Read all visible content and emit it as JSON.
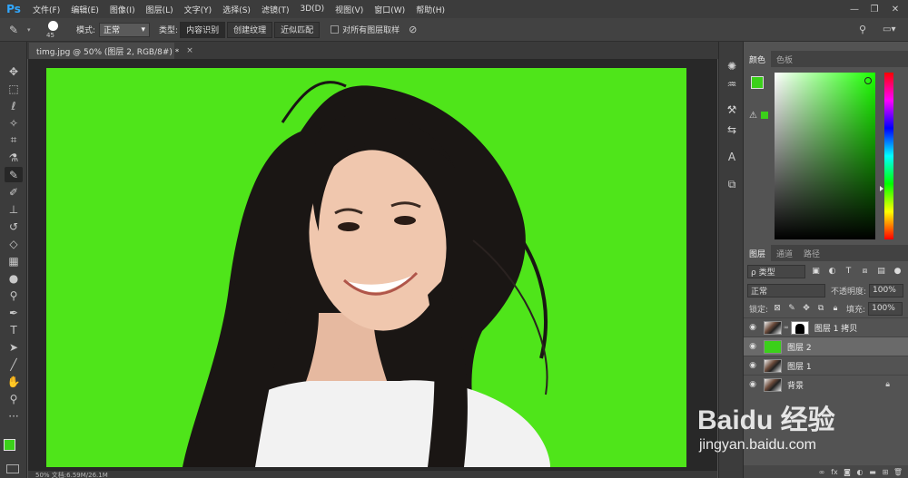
{
  "app": {
    "logo": "Ps"
  },
  "menu": [
    "文件(F)",
    "编辑(E)",
    "图像(I)",
    "图层(L)",
    "文字(Y)",
    "选择(S)",
    "滤镜(T)",
    "3D(D)",
    "视图(V)",
    "窗口(W)",
    "帮助(H)"
  ],
  "window_controls": {
    "minimize": "—",
    "restore": "❐",
    "close": "✕"
  },
  "options": {
    "brush_size": "45",
    "mode_label": "模式:",
    "mode_value": "正常",
    "type_label": "类型:",
    "type_buttons": [
      "内容识别",
      "创建纹理",
      "近似匹配"
    ],
    "sample_all_label": "对所有图层取样"
  },
  "document": {
    "tab_title": "timg.jpg @ 50% (图层 2, RGB/8#) *",
    "close": "×",
    "canvas_color": "#4fe51a",
    "status_text": "50%   文档:6.59M/26.1M"
  },
  "color_panel": {
    "tabs": [
      "颜色",
      "色板"
    ],
    "foreground": "#3bd01a",
    "background": "#ffffff"
  },
  "layers_panel": {
    "tabs": [
      "图层",
      "通道",
      "路径"
    ],
    "kind_label": "ρ 类型",
    "blend_mode": "正常",
    "opacity_label": "不透明度:",
    "opacity_value": "100%",
    "lock_label": "锁定:",
    "fill_label": "填充:",
    "fill_value": "100%",
    "layers": [
      {
        "name": "图层 1 拷贝",
        "thumb": "photo",
        "has_mask": true,
        "selected": false,
        "locked": false
      },
      {
        "name": "图层 2",
        "thumb": "green",
        "has_mask": false,
        "selected": true,
        "locked": false
      },
      {
        "name": "图层 1",
        "thumb": "photo",
        "has_mask": false,
        "selected": false,
        "locked": false
      },
      {
        "name": "背景",
        "thumb": "photo",
        "has_mask": false,
        "selected": false,
        "locked": true
      }
    ]
  },
  "watermark": {
    "brand": "Baidu 经验",
    "url": "jingyan.baidu.com"
  }
}
